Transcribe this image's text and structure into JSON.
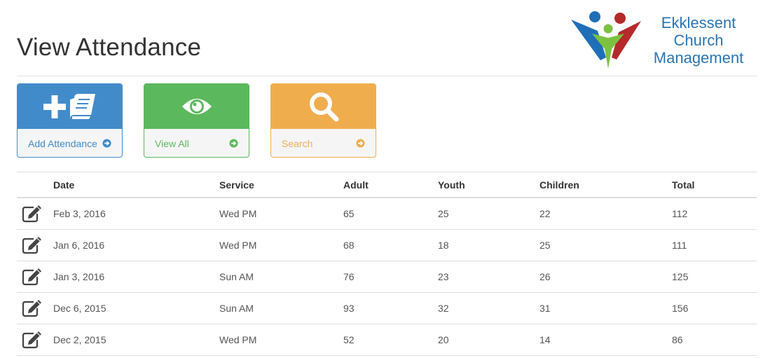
{
  "page": {
    "title": "View Attendance"
  },
  "logo": {
    "line1": "Ekklessent",
    "line2": "Church",
    "line3": "Management"
  },
  "actions": [
    {
      "id": "add",
      "label": "Add Attendance",
      "icon": "plus-book-icon",
      "color": "#428bca"
    },
    {
      "id": "view",
      "label": "View All",
      "icon": "eye-icon",
      "color": "#5cb85c"
    },
    {
      "id": "search",
      "label": "Search",
      "icon": "magnifier-icon",
      "color": "#f0ad4e"
    }
  ],
  "table": {
    "headers": [
      "Date",
      "Service",
      "Adult",
      "Youth",
      "Children",
      "Total"
    ],
    "rows": [
      [
        "Feb 3, 2016",
        "Wed PM",
        "65",
        "25",
        "22",
        "112"
      ],
      [
        "Jan 6, 2016",
        "Wed PM",
        "68",
        "18",
        "25",
        "111"
      ],
      [
        "Jan 3, 2016",
        "Sun AM",
        "76",
        "23",
        "26",
        "125"
      ],
      [
        "Dec 6, 2015",
        "Sun AM",
        "93",
        "32",
        "31",
        "156"
      ],
      [
        "Dec 2, 2015",
        "Wed PM",
        "52",
        "20",
        "14",
        "86"
      ]
    ]
  },
  "colors": {
    "edit_icon": "#444444",
    "rule": "#dddddd"
  }
}
